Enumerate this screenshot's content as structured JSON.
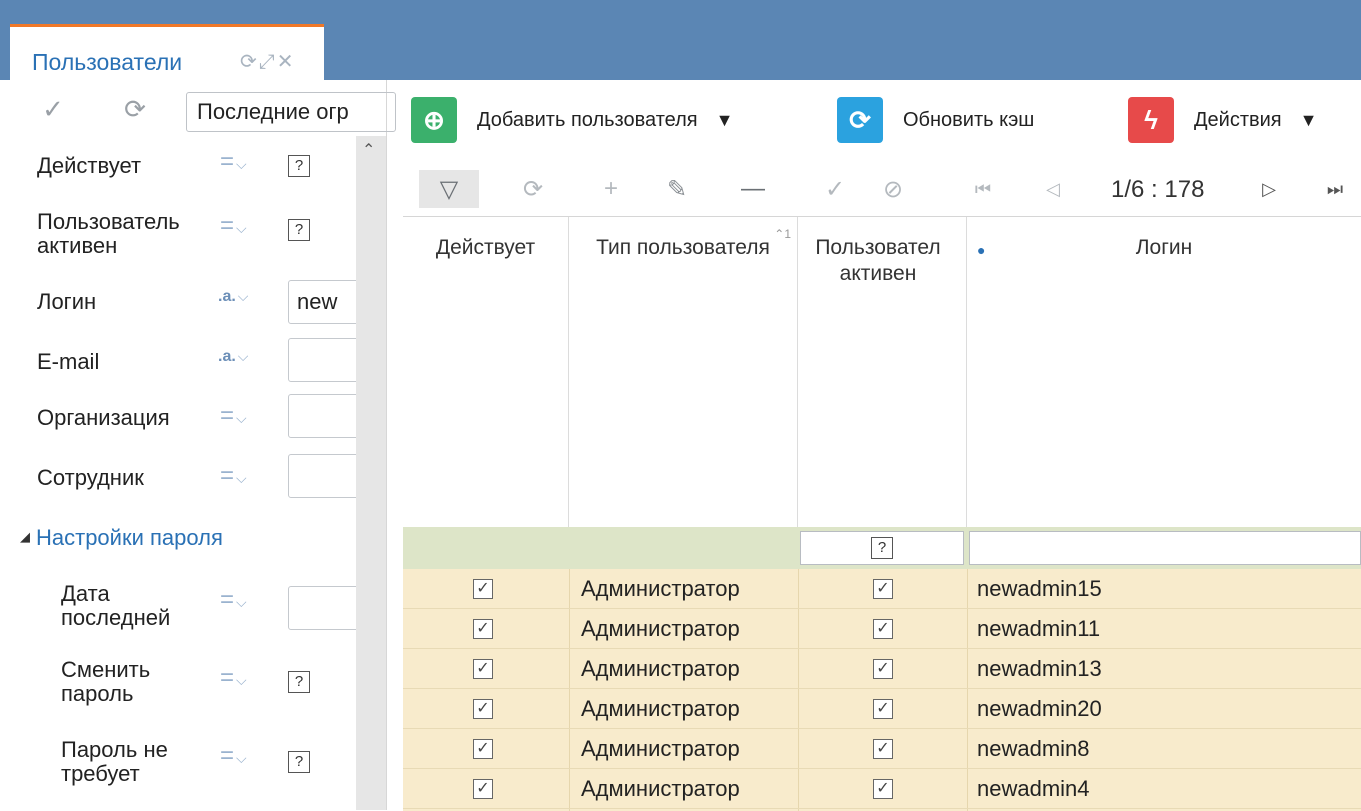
{
  "tab": {
    "title": "Пользователи"
  },
  "filters": {
    "preset": "Последние огр",
    "items": [
      {
        "label": "Действует",
        "op": "=",
        "value": "?"
      },
      {
        "label": "Пользователь активен",
        "op": "=",
        "value": "?"
      },
      {
        "label": "Логин",
        "op": ".a.",
        "value": "new"
      },
      {
        "label": "E-mail",
        "op": ".a.",
        "value": ""
      },
      {
        "label": "Организация",
        "op": "=",
        "value": ""
      },
      {
        "label": "Сотрудник",
        "op": "=",
        "value": ""
      }
    ],
    "section_label": "Настройки пароля",
    "section_items": [
      {
        "label": "Дата последней",
        "op": "=",
        "value": ""
      },
      {
        "label": "Сменить пароль",
        "op": "=",
        "value": "?"
      },
      {
        "label": "Пароль не требует",
        "op": "=",
        "value": "?"
      }
    ]
  },
  "toolbar": {
    "add_user": "Добавить пользователя",
    "refresh_cache": "Обновить кэш",
    "actions": "Действия"
  },
  "pager": {
    "text": "1/6 : 178"
  },
  "grid": {
    "columns": [
      {
        "label": "Действует"
      },
      {
        "label": "Тип пользователя"
      },
      {
        "label": "Пользовател активен"
      },
      {
        "label": "Логин"
      }
    ],
    "filter_active_value": "?",
    "rows": [
      {
        "active": true,
        "type": "Администратор",
        "user_active": true,
        "login": "newadmin15"
      },
      {
        "active": true,
        "type": "Администратор",
        "user_active": true,
        "login": "newadmin11"
      },
      {
        "active": true,
        "type": "Администратор",
        "user_active": true,
        "login": "newadmin13"
      },
      {
        "active": true,
        "type": "Администратор",
        "user_active": true,
        "login": "newadmin20"
      },
      {
        "active": true,
        "type": "Администратор",
        "user_active": true,
        "login": "newadmin8"
      },
      {
        "active": true,
        "type": "Администратор",
        "user_active": true,
        "login": "newadmin4"
      }
    ]
  },
  "colors": {
    "topbar": "#5b86b4",
    "accent": "#f07828",
    "link": "#2a71b5",
    "filter_row": "#dde5c8",
    "row_bg": "#f8ebcc"
  }
}
